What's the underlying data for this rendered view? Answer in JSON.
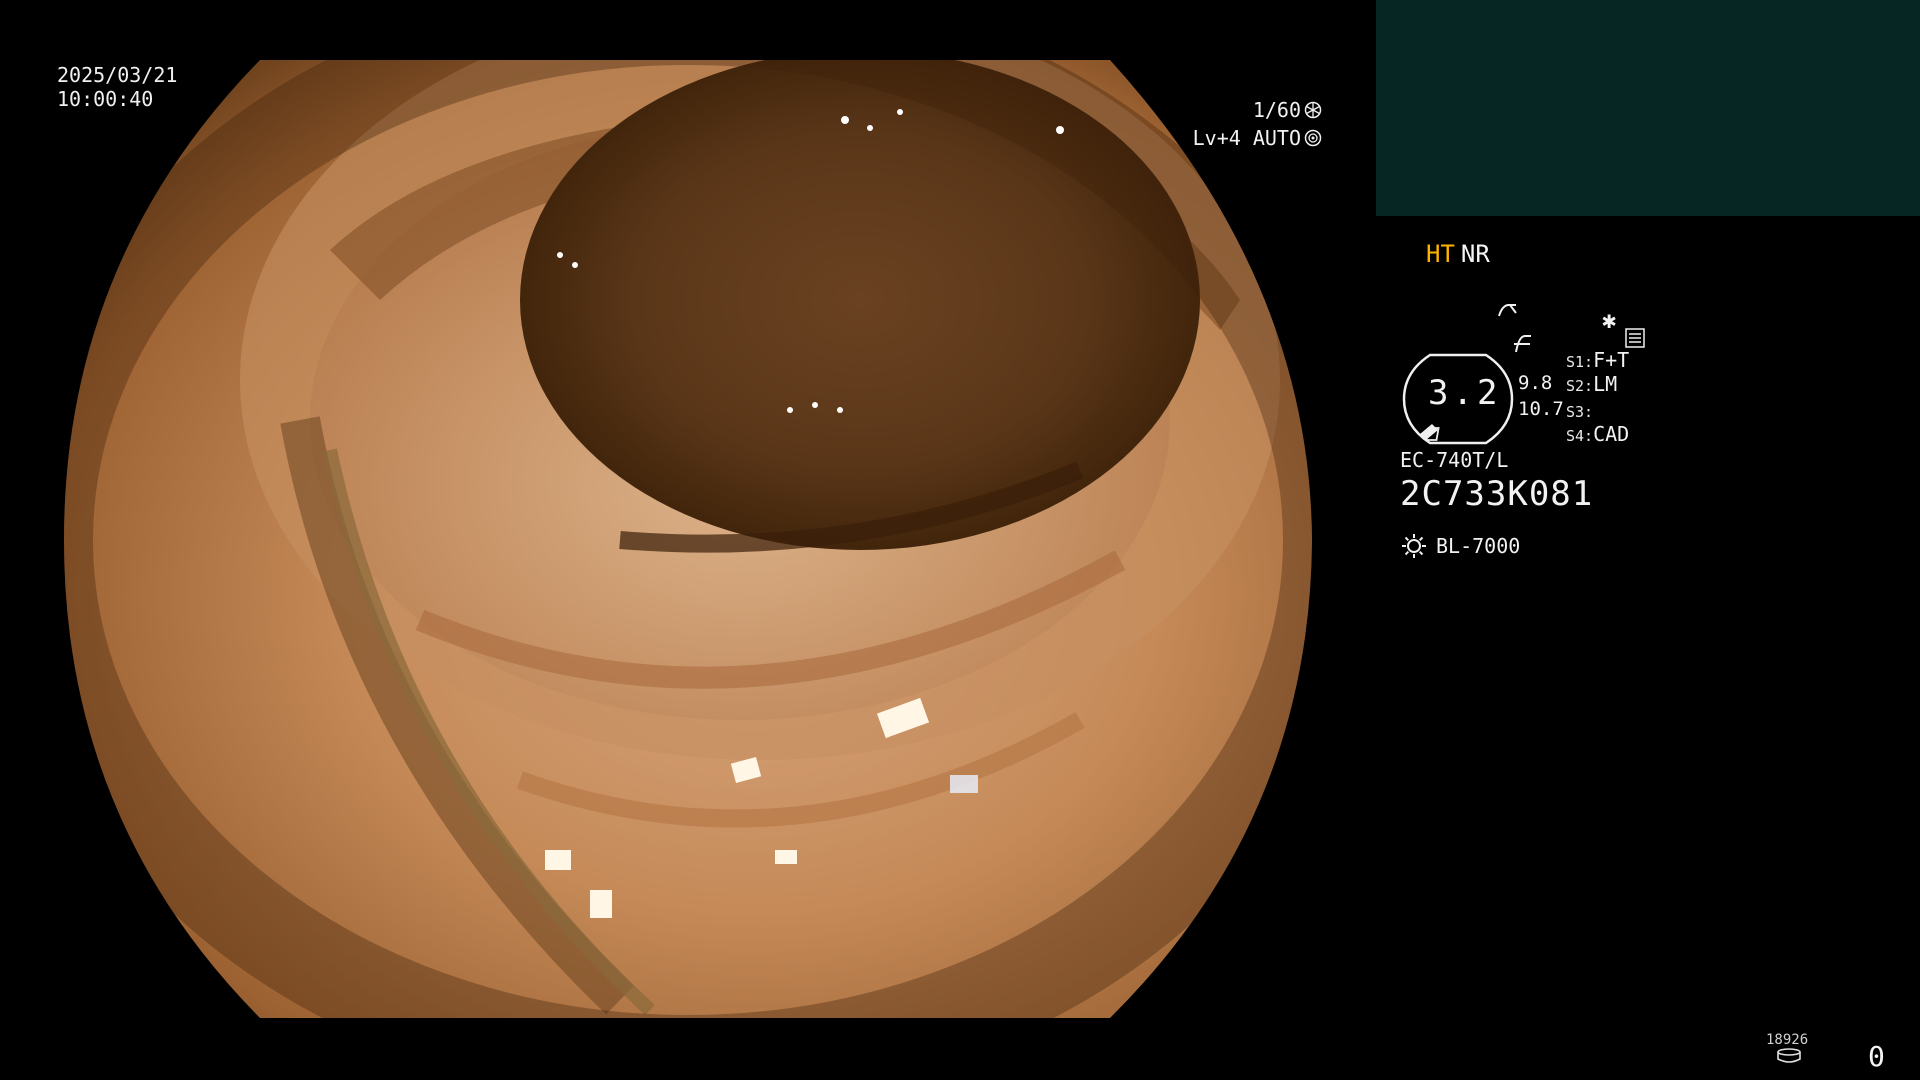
{
  "osd": {
    "date": "2025/03/21",
    "time": "10:00:40",
    "shutter": "1/60",
    "level_auto": "Lv+4 AUTO"
  },
  "panel": {
    "mode_ht": "HT",
    "mode_nr": "NR",
    "zoom_value": "3.2",
    "zoom_sub1": "9.8",
    "zoom_sub2": "10.7",
    "slots": [
      {
        "key": "S1:",
        "value": "F+T"
      },
      {
        "key": "S2:",
        "value": "LM"
      },
      {
        "key": "S3:",
        "value": ""
      },
      {
        "key": "S4:",
        "value": "CAD"
      }
    ],
    "scope_model": "EC-740T/L",
    "scope_serial": "2C733K081",
    "light_source": "BL-7000",
    "counter_label": "18926",
    "frame_count": "0"
  },
  "colors": {
    "background": "#000000",
    "sub_monitor": "#052622",
    "ht_accent": "#ffb400",
    "text": "#f2f2f2"
  },
  "icons": [
    "aperture-icon",
    "iris-icon",
    "scope-bend-icon",
    "signal-icon",
    "list-icon",
    "star-icon",
    "light-source-icon",
    "storage-icon"
  ]
}
